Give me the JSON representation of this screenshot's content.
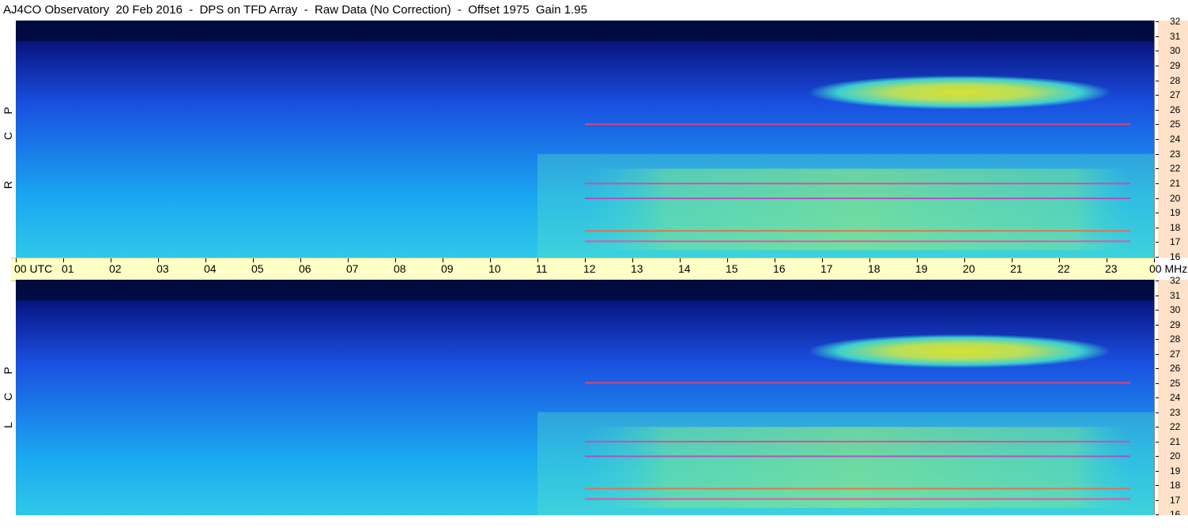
{
  "title": "AJ4CO Observatory  20 Feb 2016  -  DPS on TFD Array  -  Raw Data (No Correction)  -  Offset 1975  Gain 1.95",
  "panels": [
    {
      "id": "rcp",
      "label": [
        "R",
        "C",
        "P"
      ]
    },
    {
      "id": "lcp",
      "label": [
        "L",
        "C",
        "P"
      ]
    }
  ],
  "time_axis": {
    "first_label": "00  UTC",
    "hours": [
      "01",
      "02",
      "03",
      "04",
      "05",
      "06",
      "07",
      "08",
      "09",
      "10",
      "11",
      "12",
      "13",
      "14",
      "15",
      "16",
      "17",
      "18",
      "19",
      "20",
      "21",
      "22",
      "23"
    ],
    "last_label": "00 MHz"
  },
  "freq_axis": {
    "labels": [
      "32",
      "31",
      "30",
      "29",
      "28",
      "27",
      "26",
      "25",
      "24",
      "23",
      "22",
      "21",
      "20",
      "19",
      "18",
      "17",
      "16"
    ]
  },
  "chart_data": {
    "type": "heatmap",
    "title": "AJ4CO Observatory  20 Feb 2016  -  DPS on TFD Array  -  Raw Data (No Correction)  -  Offset 1975  Gain 1.95",
    "x": {
      "label": "UTC",
      "range": [
        0,
        24
      ],
      "ticks": [
        "00",
        "01",
        "02",
        "03",
        "04",
        "05",
        "06",
        "07",
        "08",
        "09",
        "10",
        "11",
        "12",
        "13",
        "14",
        "15",
        "16",
        "17",
        "18",
        "19",
        "20",
        "21",
        "22",
        "23",
        "00"
      ]
    },
    "y": {
      "label": "MHz",
      "range": [
        16,
        32
      ],
      "ticks": [
        32,
        31,
        30,
        29,
        28,
        27,
        26,
        25,
        24,
        23,
        22,
        21,
        20,
        19,
        18,
        17,
        16
      ]
    },
    "series": [
      {
        "name": "RCP"
      },
      {
        "name": "LCP"
      }
    ],
    "colormap": [
      "#000a3c",
      "#0a1a8c",
      "#1a4fe0",
      "#1aa8f0",
      "#40e0d0",
      "#c8f050",
      "#f0f020",
      "#ff4060"
    ],
    "features": [
      {
        "type": "emission",
        "time_range": [
          16.7,
          23.1
        ],
        "freq_range": [
          26,
          28.3
        ]
      },
      {
        "type": "emission",
        "time_range": [
          12,
          23.5
        ],
        "freq_range": [
          16.5,
          22
        ]
      },
      {
        "type": "interference_line",
        "freq": 25
      },
      {
        "type": "interference_line",
        "freq": 21
      },
      {
        "type": "interference_line",
        "freq": 20
      },
      {
        "type": "interference_line",
        "freq": 17.8
      },
      {
        "type": "interference_line",
        "freq": 17.1
      }
    ]
  },
  "colors": {
    "axis_bg": "#ffffc6",
    "freq_bg": "#ffe0c8"
  }
}
